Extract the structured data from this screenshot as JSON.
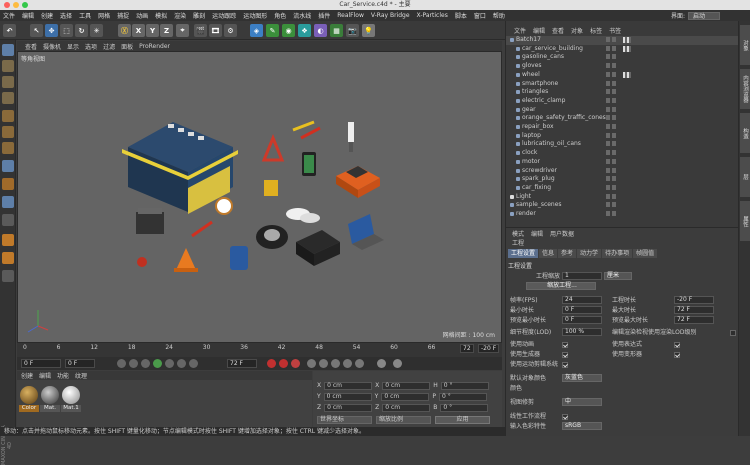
{
  "window": {
    "title": "Car_Service.c4d * - 主要"
  },
  "menubar": [
    "文件",
    "编辑",
    "创建",
    "选择",
    "工具",
    "网格",
    "捕捉",
    "动画",
    "模拟",
    "渲染",
    "雕刻",
    "运动跟踪",
    "运动图形",
    "角色",
    "流水线",
    "插件",
    "RealFlow",
    "V-Ray Bridge",
    "X-Particles",
    "脚本",
    "窗口",
    "帮助"
  ],
  "layout": {
    "label": "界面:",
    "value": "启动"
  },
  "toolbar": {
    "axis_x": "X",
    "axis_y": "Y",
    "axis_z": "Z"
  },
  "viewport": {
    "menu": [
      "查看",
      "摄像机",
      "显示",
      "选项",
      "过滤",
      "面板",
      "ProRender"
    ],
    "label": "等角视图",
    "grid": "网格间距 : 100 cm"
  },
  "timeline": {
    "ticks": [
      "0",
      "6",
      "12",
      "18",
      "24",
      "30",
      "36",
      "42",
      "48",
      "54",
      "60",
      "66",
      "72"
    ],
    "current_label": "72",
    "end_label": "-20 F",
    "start_frame": "0 F",
    "field2": "0 F",
    "field3": "72 F",
    "field4": "72 F"
  },
  "material_panel": {
    "menu": [
      "创建",
      "编辑",
      "功能",
      "纹理"
    ],
    "items": [
      {
        "label": "Color",
        "color": "#a07840"
      },
      {
        "label": "Mat.",
        "color": "#888888"
      },
      {
        "label": "Mat.1",
        "color": "#dcdcdc"
      }
    ]
  },
  "coordinates": {
    "rows": [
      {
        "axis": "X",
        "pos": "0 cm",
        "axis2": "X",
        "size": "0 cm",
        "rot_axis": "H",
        "rot": "0 °"
      },
      {
        "axis": "Y",
        "pos": "0 cm",
        "axis2": "Y",
        "size": "0 cm",
        "rot_axis": "P",
        "rot": "0 °"
      },
      {
        "axis": "Z",
        "pos": "0 cm",
        "axis2": "Z",
        "size": "0 cm",
        "rot_axis": "B",
        "rot": "0 °"
      }
    ],
    "mode": "世界坐标",
    "scale_mode": "缩放比例",
    "apply": "应用"
  },
  "object_manager": {
    "menu": [
      "文件",
      "编辑",
      "查看",
      "对象",
      "标签",
      "书签"
    ],
    "objects": [
      {
        "name": "Batch17",
        "indent": 0,
        "tag": true
      },
      {
        "name": "car_service_building",
        "indent": 1,
        "tag": true
      },
      {
        "name": "gasoline_cans",
        "indent": 1,
        "tag": false
      },
      {
        "name": "gloves",
        "indent": 1,
        "tag": false
      },
      {
        "name": "wheel",
        "indent": 1,
        "tag": true
      },
      {
        "name": "smartphone",
        "indent": 1,
        "tag": false
      },
      {
        "name": "triangles",
        "indent": 1,
        "tag": false
      },
      {
        "name": "electric_clamp",
        "indent": 1,
        "tag": false
      },
      {
        "name": "gear",
        "indent": 1,
        "tag": false
      },
      {
        "name": "orange_safety_traffic_cones",
        "indent": 1,
        "tag": false
      },
      {
        "name": "repair_box",
        "indent": 1,
        "tag": false
      },
      {
        "name": "laptop",
        "indent": 1,
        "tag": false
      },
      {
        "name": "lubricating_oil_cans",
        "indent": 1,
        "tag": false
      },
      {
        "name": "clock",
        "indent": 1,
        "tag": false
      },
      {
        "name": "motor",
        "indent": 1,
        "tag": false
      },
      {
        "name": "screwdriver",
        "indent": 1,
        "tag": false
      },
      {
        "name": "spark_plug",
        "indent": 1,
        "tag": false
      },
      {
        "name": "car_fixing",
        "indent": 1,
        "tag": false
      },
      {
        "name": "Light",
        "indent": 0,
        "tag": false
      },
      {
        "name": "sample_scenes",
        "indent": 0,
        "tag": false
      },
      {
        "name": "render",
        "indent": 0,
        "tag": false
      }
    ]
  },
  "attributes": {
    "menu": [
      "模式",
      "编辑",
      "用户数据"
    ],
    "title": "工程",
    "tabs": [
      "工程设置",
      "信息",
      "参考",
      "动力学",
      "待办事项",
      "帧圆值"
    ],
    "section": "工程设置",
    "scale_label": "工程缩放",
    "scale_value": "1",
    "scale_unit": "厘米",
    "scale_button": "缩放工程...",
    "fps_label": "帧率(FPS)",
    "fps_value": "24",
    "duration_label": "工程时长",
    "duration_value": "-20 F",
    "mintime_label": "最小时长",
    "mintime_value": "0 F",
    "maxtime_label": "最大时长",
    "maxtime_value": "72 F",
    "preview_min_label": "预览最小时长",
    "preview_min_value": "0 F",
    "preview_max_label": "预览最大时长",
    "preview_max_value": "72 F",
    "lod_label": "细节程度(LOD)",
    "lod_value": "100 %",
    "lod_render_label": "编辑渲染检视使用渲染LOD级别",
    "use_anim_label": "使用动画",
    "use_expr_label": "使用表达式",
    "use_gen_label": "使用生成器",
    "use_deform_label": "使用变形器",
    "use_motion_label": "使用运动剪辑系统",
    "default_color_label": "默认对象颜色",
    "default_color_value": "灰蓝色",
    "color_label": "颜色",
    "view_clip_label": "视图修剪",
    "view_clip_value": "中",
    "linear_label": "线性工作流程",
    "input_color_label": "输入色彩特性",
    "input_color_value": "sRGB"
  },
  "right_strip": [
    "对象",
    "内容浏览器",
    "构造",
    "层",
    "属性"
  ],
  "status": "移动：点击并拖动鼠标移动元素。按住 SHIFT 键量化移动；节点编辑模式时按住 SHIFT 键增加选择对象；按住 CTRL 键减少选择对象。",
  "brand": "MAXON CINEMA 4D"
}
